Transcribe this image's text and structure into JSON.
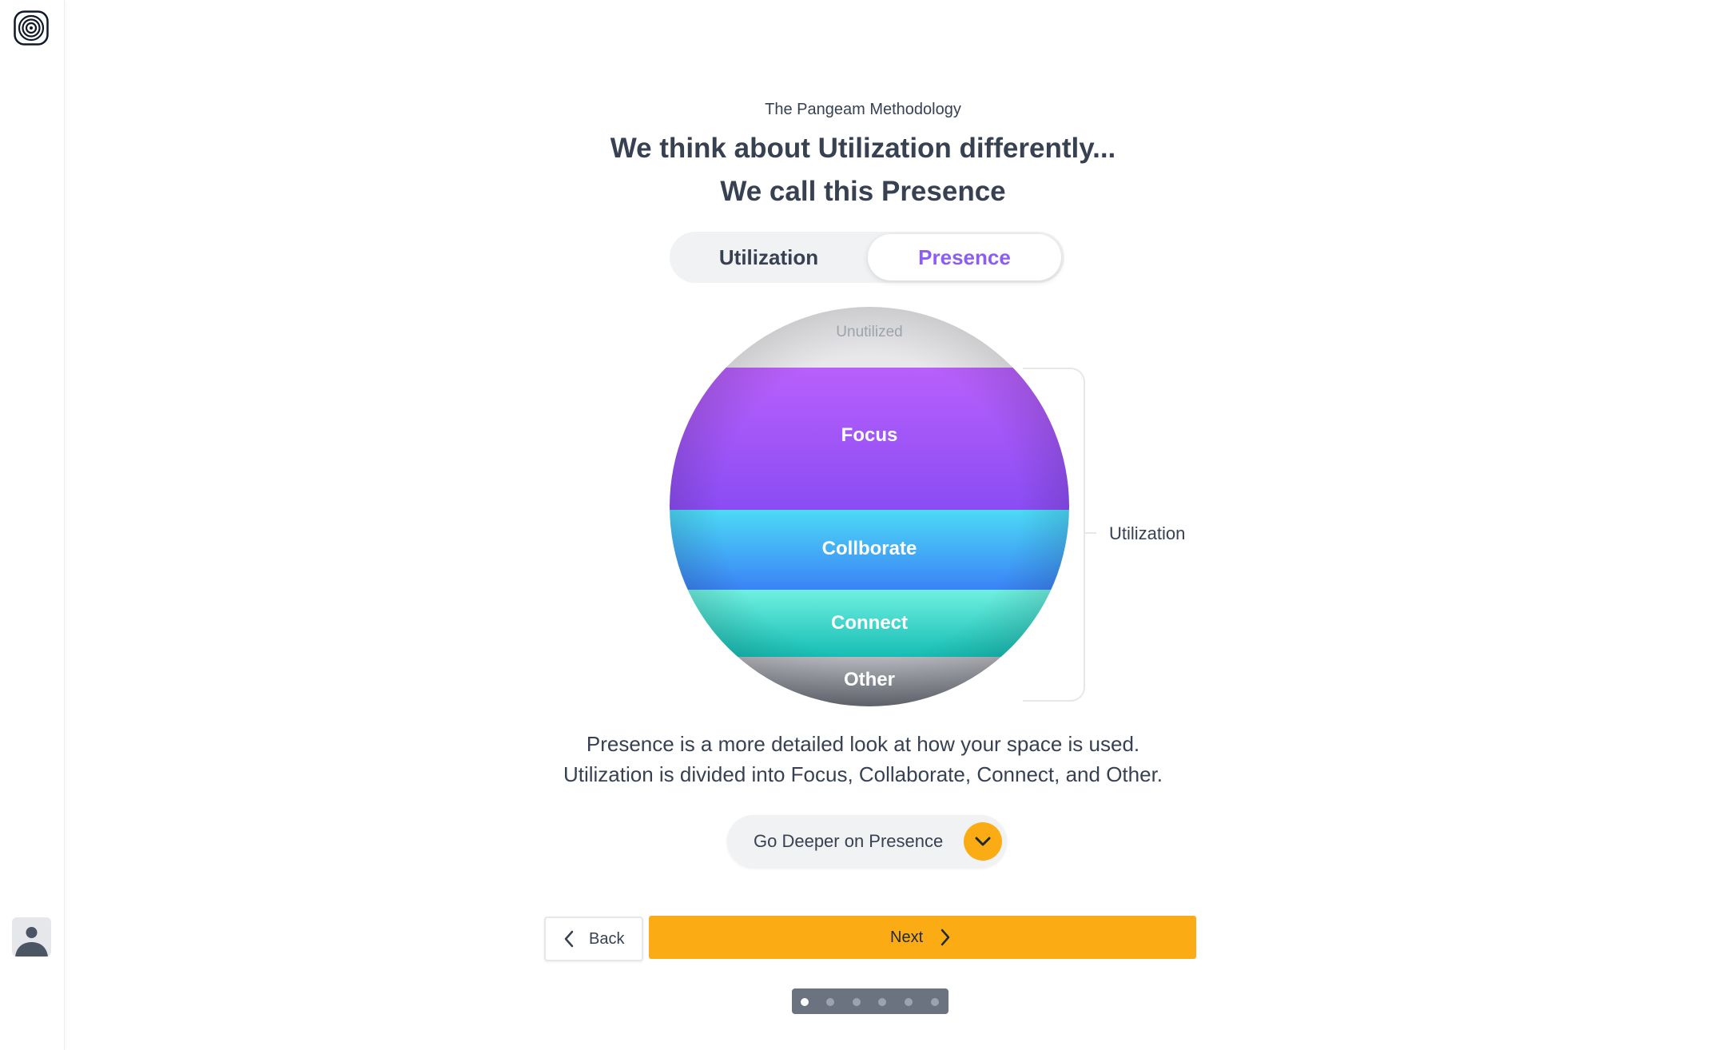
{
  "header": {
    "overline": "The Pangeam Methodology",
    "title_line1": "We think about Utilization differently...",
    "title_line2": "We call this Presence"
  },
  "toggle": {
    "options": [
      "Utilization",
      "Presence"
    ],
    "selected": "Presence"
  },
  "diagram": {
    "bands": [
      {
        "label": "Unutilized",
        "color": "#e7e7e9"
      },
      {
        "label": "Focus",
        "color": "#9a4ef5"
      },
      {
        "label": "Collborate",
        "color": "#38bdf8"
      },
      {
        "label": "Connect",
        "color": "#2dd4bf"
      },
      {
        "label": "Other",
        "color": "#8e9099"
      }
    ],
    "bracket_label": "Utilization"
  },
  "description": {
    "line1": "Presence is a more detailed look at how your space is used.",
    "line2": "Utilization is divided into Focus, Collaborate, Connect, and Other."
  },
  "deeper_button": {
    "label": "Go Deeper on Presence",
    "icon": "chevron-down-icon"
  },
  "nav": {
    "back_label": "Back",
    "next_label": "Next"
  },
  "progress": {
    "total": 6,
    "current": 1
  },
  "colors": {
    "accent": "#fbab14",
    "selected_text": "#8b5cf6",
    "text": "#374151"
  }
}
